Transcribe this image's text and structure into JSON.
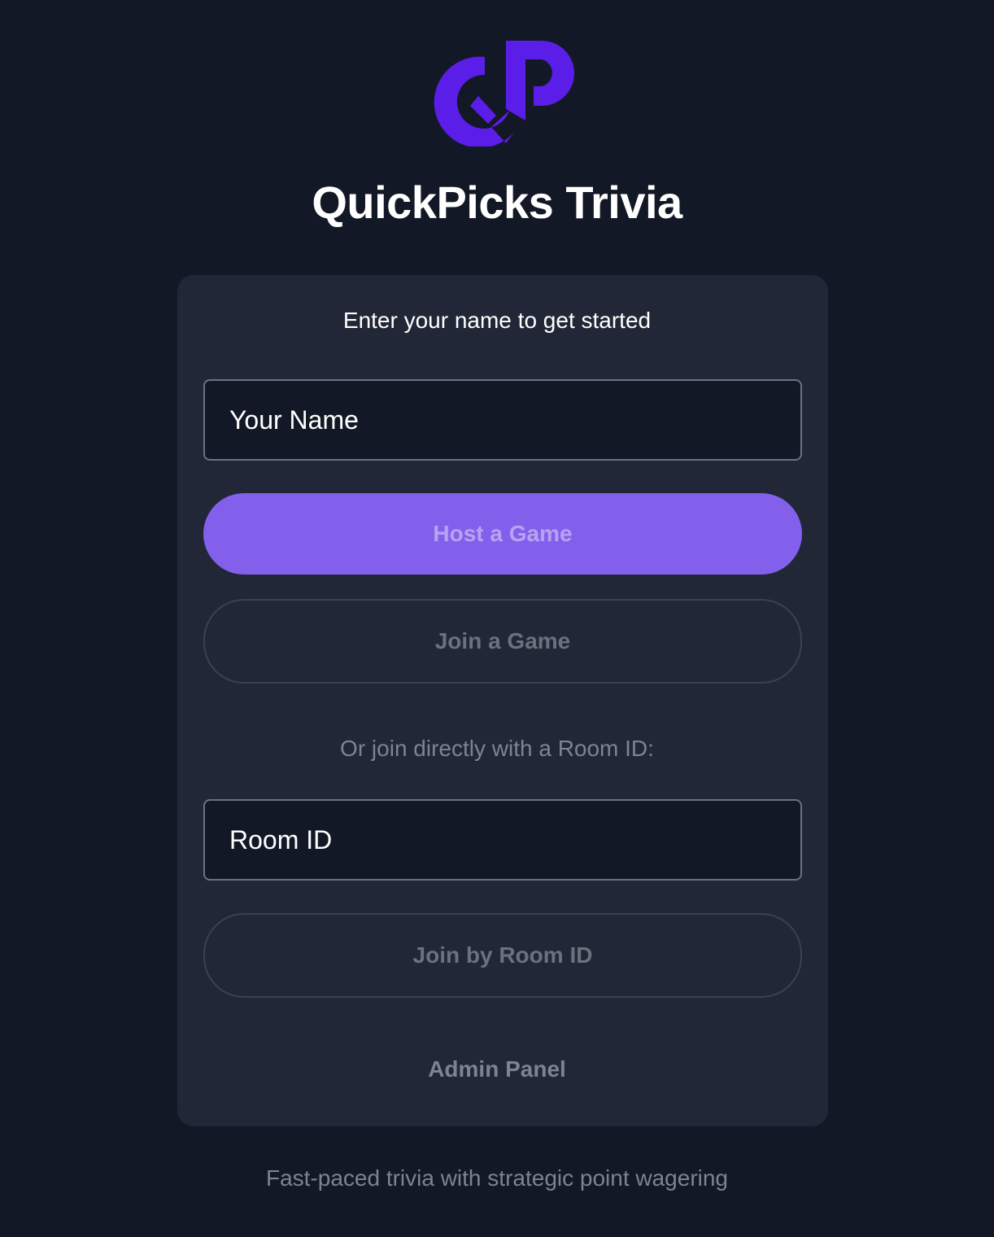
{
  "app": {
    "title": "QuickPicks Trivia",
    "logo_icon": "qp-logo-icon",
    "brand_color": "#5a1ee8"
  },
  "form": {
    "subtitle": "Enter your name to get started",
    "name_placeholder": "Your Name",
    "host_button_label": "Host a Game",
    "join_button_label": "Join a Game",
    "or_text": "Or join directly with a Room ID:",
    "room_placeholder": "Room ID",
    "join_room_button_label": "Join by Room ID",
    "admin_link_label": "Admin Panel"
  },
  "footer": {
    "tagline": "Fast-paced trivia with strategic point wagering"
  },
  "colors": {
    "background": "#131826",
    "card": "#212736",
    "primary_button": "#8360ec",
    "muted_text": "#7e8391"
  }
}
